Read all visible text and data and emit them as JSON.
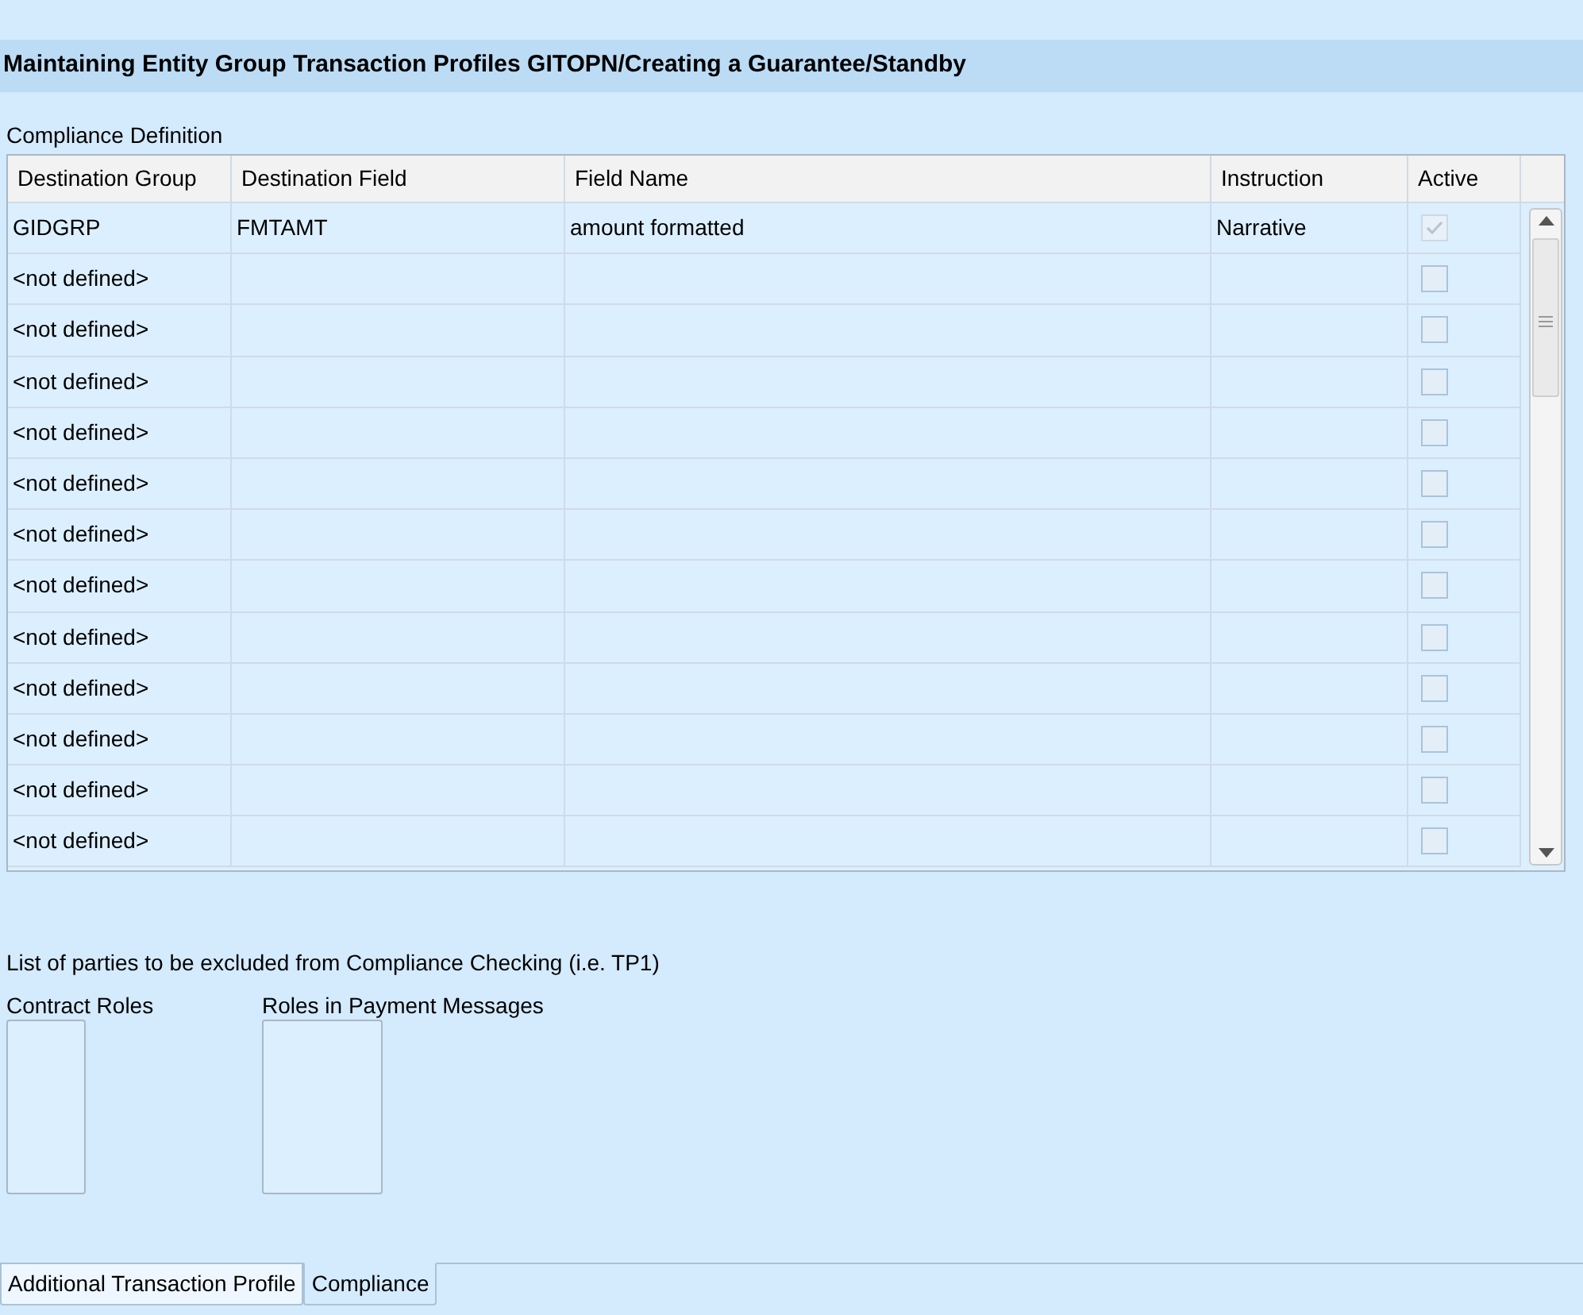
{
  "window": {
    "title": "Maintaining Entity Group Transaction Profiles GITOPN/Creating a Guarantee/Standby"
  },
  "compliance_definition": {
    "title": "Compliance Definition",
    "columns": [
      "Destination Group",
      "Destination Field",
      "Field Name",
      "Instruction",
      "Active"
    ],
    "rows": [
      {
        "destination_group": "GIDGRP",
        "destination_field": "FMTAMT",
        "field_name": "amount formatted",
        "instruction": "Narrative",
        "active": true,
        "disabled": true
      },
      {
        "destination_group": "<not defined>",
        "active": false,
        "disabled": false
      },
      {
        "destination_group": "<not defined>",
        "active": false,
        "disabled": false
      },
      {
        "destination_group": "<not defined>",
        "active": false,
        "disabled": false
      },
      {
        "destination_group": "<not defined>",
        "active": false,
        "disabled": false
      },
      {
        "destination_group": "<not defined>",
        "active": false,
        "disabled": false
      },
      {
        "destination_group": "<not defined>",
        "active": false,
        "disabled": false
      },
      {
        "destination_group": "<not defined>",
        "active": false,
        "disabled": false
      },
      {
        "destination_group": "<not defined>",
        "active": false,
        "disabled": false
      },
      {
        "destination_group": "<not defined>",
        "active": false,
        "disabled": false
      },
      {
        "destination_group": "<not defined>",
        "active": false,
        "disabled": false
      },
      {
        "destination_group": "<not defined>",
        "active": false,
        "disabled": false
      },
      {
        "destination_group": "<not defined>",
        "active": false,
        "disabled": false
      }
    ]
  },
  "exclusions": {
    "title": "List of parties to be excluded from Compliance Checking (i.e. TP1)",
    "lists": [
      {
        "label": "Contract Roles"
      },
      {
        "label": "Roles in Payment Messages"
      }
    ]
  },
  "tabs": [
    {
      "label": "Additional Transaction Profile",
      "selected": false
    },
    {
      "label": "Compliance",
      "selected": true
    }
  ]
}
